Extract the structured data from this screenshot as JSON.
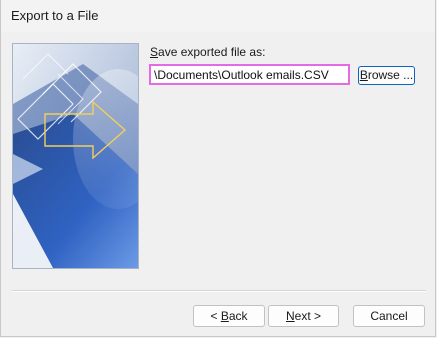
{
  "window": {
    "title": "Export to a File"
  },
  "save": {
    "label_accel": "S",
    "label_rest": "ave exported file as:",
    "path_value": "\\Documents\\Outlook emails.CSV"
  },
  "buttons": {
    "browse_accel": "B",
    "browse_rest": "rowse ...",
    "back_prefix": "< ",
    "back_accel": "B",
    "back_rest": "ack",
    "next_accel": "N",
    "next_rest": "ext >",
    "cancel": "Cancel"
  },
  "colors": {
    "input_highlight": "#e56be6",
    "browse_focus_border": "#0a64c2",
    "arrow_outline": "#f2cf5b"
  }
}
